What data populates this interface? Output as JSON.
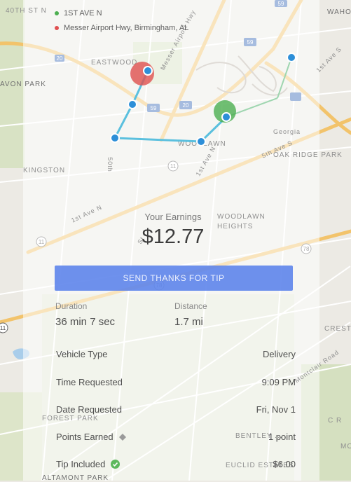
{
  "legend": {
    "pickup": {
      "label": "1ST AVE N",
      "color": "#4caf50"
    },
    "dropoff": {
      "label": "Messer Airport Hwy, Birmingham, AL",
      "color": "#e05050"
    }
  },
  "map_labels": {
    "st40": "40th St N",
    "wahoo": "WAHOO",
    "eastwood": "EASTWOOD",
    "avon_park": "AVON PARK",
    "kingston": "KINGSTON",
    "woodlawn": "WOODLAWN",
    "woodlawn_heights": "WOODLAWN HEIGHTS",
    "oak_ridge_park": "OAK RIDGE PARK",
    "georgia": "Georgia",
    "fifth_ave_s": "5th Ave S",
    "first_ave_n": "1st Ave N",
    "st50": "50th",
    "crest": "CREST",
    "forest_park": "FOREST PARK",
    "bentley": "BENTLEY ...",
    "euclid": "EUCLID ESTATES",
    "altamont_park": "ALTAMONT PARK",
    "montclair": "Montclair Road",
    "messer": "Messer Airport Hwy",
    "first_ave_s": "1st Ave S",
    "hwy": "Hwy",
    "st": "St",
    "cr": "C R",
    "mo": "MO",
    "road": "Road",
    "i20": "20",
    "i59": "59",
    "i59b": "59",
    "i59c": "59",
    "us11": "11",
    "us11b": "11",
    "us78": "78",
    "us78b": "78",
    "us11c": "11"
  },
  "earnings": {
    "label": "Your Earnings",
    "value": "$12.77"
  },
  "tip_button": {
    "label": "SEND THANKS FOR TIP"
  },
  "stats": {
    "duration": {
      "label": "Duration",
      "value": "36 min 7 sec"
    },
    "distance": {
      "label": "Distance",
      "value": "1.7 mi"
    }
  },
  "details": [
    {
      "label": "Vehicle Type",
      "value": "Delivery"
    },
    {
      "label": "Time Requested",
      "value": "9:09 PM"
    },
    {
      "label": "Date Requested",
      "value": "Fri, Nov 1"
    },
    {
      "label": "Points Earned",
      "value": "1 point",
      "icon": "diamond-icon"
    },
    {
      "label": "Tip Included",
      "value": "$6.00",
      "icon": "check-circle-icon"
    }
  ],
  "colors": {
    "route": "#5bc0de",
    "button": "#5a82eb",
    "highway": "#f2c36b"
  }
}
